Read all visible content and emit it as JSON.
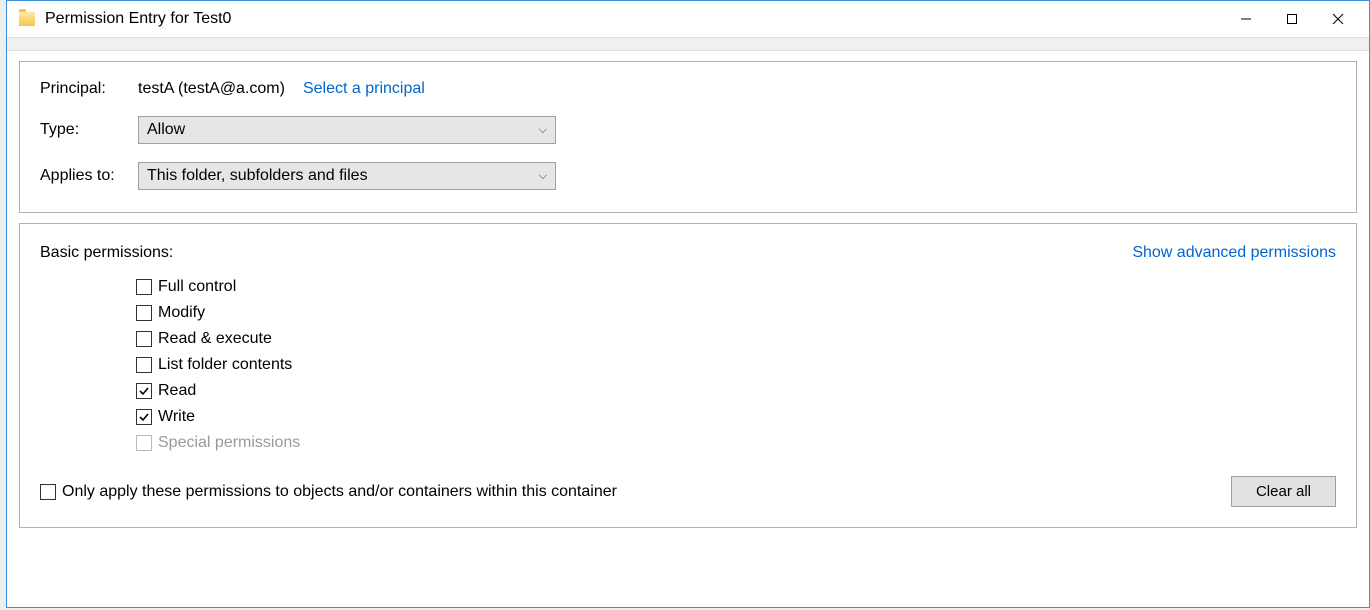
{
  "window": {
    "title": "Permission Entry for Test0"
  },
  "principal": {
    "label": "Principal:",
    "value": "testA (testA@a.com)",
    "select_link": "Select a principal"
  },
  "type": {
    "label": "Type:",
    "value": "Allow"
  },
  "applies_to": {
    "label": "Applies to:",
    "value": "This folder, subfolders and files"
  },
  "permissions": {
    "title": "Basic permissions:",
    "advanced_link": "Show advanced permissions",
    "items": [
      {
        "label": "Full control",
        "checked": false,
        "disabled": false
      },
      {
        "label": "Modify",
        "checked": false,
        "disabled": false
      },
      {
        "label": "Read & execute",
        "checked": false,
        "disabled": false
      },
      {
        "label": "List folder contents",
        "checked": false,
        "disabled": false
      },
      {
        "label": "Read",
        "checked": true,
        "disabled": false
      },
      {
        "label": "Write",
        "checked": true,
        "disabled": false
      },
      {
        "label": "Special permissions",
        "checked": false,
        "disabled": true
      }
    ],
    "only_apply": {
      "label": "Only apply these permissions to objects and/or containers within this container",
      "checked": false
    },
    "clear_all": "Clear all"
  }
}
